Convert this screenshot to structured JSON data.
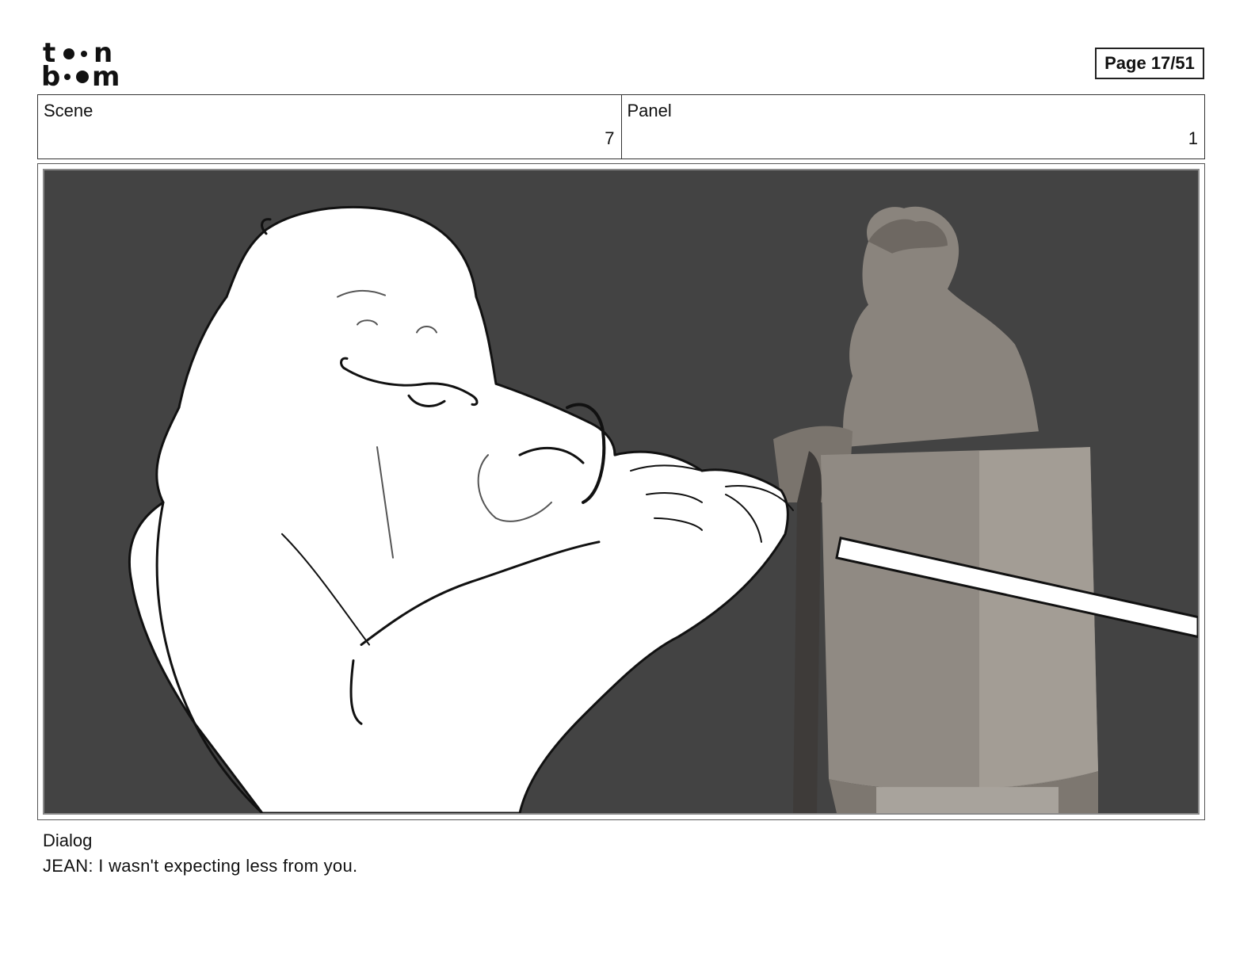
{
  "header": {
    "logo_text": "toon boom",
    "page_indicator": "Page 17/51"
  },
  "scene": {
    "label": "Scene",
    "value": "7"
  },
  "panel": {
    "label": "Panel",
    "value": "1"
  },
  "dialog": {
    "label": "Dialog",
    "text": "JEAN: I wasn't expecting less from you."
  },
  "colors": {
    "panel_background": "#434343",
    "sketch_fill": "#ffffff",
    "sketch_line": "#111111",
    "statue": "#9a948d"
  }
}
